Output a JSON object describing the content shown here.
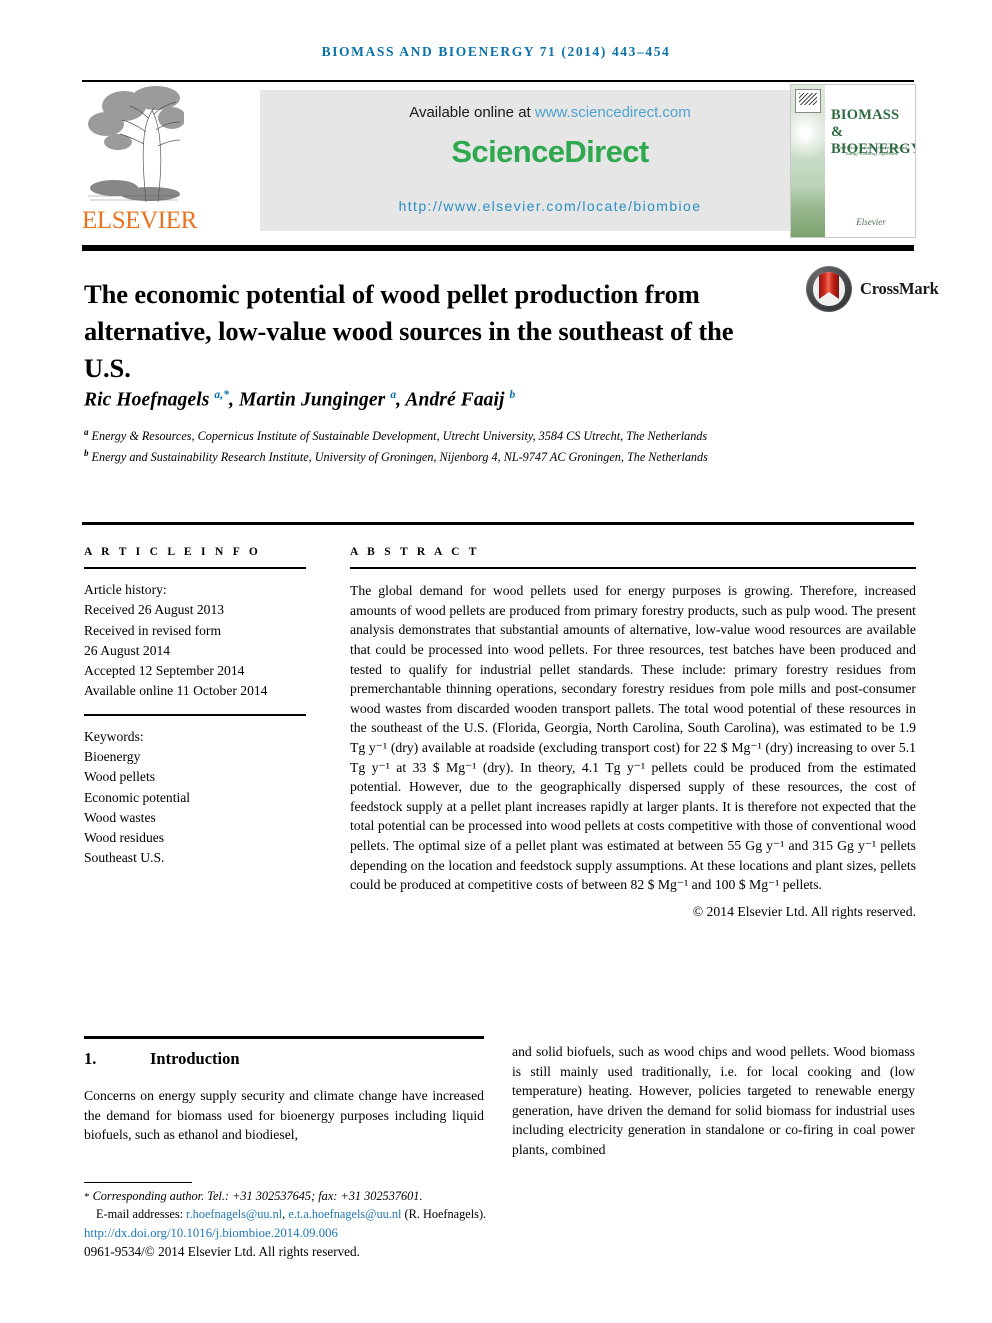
{
  "running_head": "BIOMASS AND BIOENERGY 71 (2014) 443–454",
  "banner": {
    "publisher_logo_text": "ELSEVIER",
    "available_online_prefix": "Available online at ",
    "sciencedirect_url": "www.sciencedirect.com",
    "sciencedirect_logo": "ScienceDirect",
    "journal_url": "http://www.elsevier.com/locate/biombioe",
    "cover": {
      "title_line1": "BIOMASS &",
      "title_line2": "BIOENERGY",
      "subtitle": "The Official Journal of the International Energy Bioenergy Agreement",
      "publisher": "Elsevier"
    }
  },
  "crossmark": {
    "label": "CrossMark"
  },
  "article": {
    "title": "The economic potential of wood pellet production from alternative, low-value wood sources in the southeast of the U.S.",
    "authors_html": "Ric Hoefnagels <sup>a,*</sup>, Martin Junginger <sup>a</sup>, André Faaij <sup>b</sup>",
    "affiliations": [
      {
        "marker": "a",
        "text": "Energy & Resources, Copernicus Institute of Sustainable Development, Utrecht University, 3584 CS Utrecht, The Netherlands"
      },
      {
        "marker": "b",
        "text": "Energy and Sustainability Research Institute, University of Groningen, Nijenborg 4, NL-9747 AC Groningen, The Netherlands"
      }
    ]
  },
  "article_info": {
    "heading": "A R T I C L E   I N F O",
    "history_label": "Article history:",
    "history": [
      "Received 26 August 2013",
      "Received in revised form",
      "26 August 2014",
      "Accepted 12 September 2014",
      "Available online 11 October 2014"
    ],
    "keywords_label": "Keywords:",
    "keywords": [
      "Bioenergy",
      "Wood pellets",
      "Economic potential",
      "Wood wastes",
      "Wood residues",
      "Southeast U.S."
    ]
  },
  "abstract": {
    "heading": "A B S T R A C T",
    "text": "The global demand for wood pellets used for energy purposes is growing. Therefore, increased amounts of wood pellets are produced from primary forestry products, such as pulp wood. The present analysis demonstrates that substantial amounts of alternative, low-value wood resources are available that could be processed into wood pellets. For three resources, test batches have been produced and tested to qualify for industrial pellet standards. These include: primary forestry residues from premerchantable thinning operations, secondary forestry residues from pole mills and post-consumer wood wastes from discarded wooden transport pallets. The total wood potential of these resources in the southeast of the U.S. (Florida, Georgia, North Carolina, South Carolina), was estimated to be 1.9 Tg y⁻¹ (dry) available at roadside (excluding transport cost) for 22 $ Mg⁻¹ (dry) increasing to over 5.1 Tg y⁻¹ at 33 $ Mg⁻¹ (dry). In theory, 4.1 Tg y⁻¹ pellets could be produced from the estimated potential. However, due to the geographically dispersed supply of these resources, the cost of feedstock supply at a pellet plant increases rapidly at larger plants. It is therefore not expected that the total potential can be processed into wood pellets at costs competitive with those of conventional wood pellets. The optimal size of a pellet plant was estimated at between 55 Gg y⁻¹ and 315 Gg y⁻¹ pellets depending on the location and feedstock supply assumptions. At these locations and plant sizes, pellets could be produced at competitive costs of between 82 $ Mg⁻¹ and 100 $ Mg⁻¹ pellets.",
    "copyright": "© 2014 Elsevier Ltd. All rights reserved."
  },
  "body": {
    "section_number": "1.",
    "section_title": "Introduction",
    "column_left": "Concerns on energy supply security and climate change have increased the demand for biomass used for bioenergy purposes including liquid biofuels, such as ethanol and biodiesel,",
    "column_right": "and solid biofuels, such as wood chips and wood pellets. Wood biomass is still mainly used traditionally, i.e. for local cooking and (low temperature) heating. However, policies targeted to renewable energy generation, have driven the demand for solid biomass for industrial uses including electricity generation in standalone or co-firing in coal power plants, combined"
  },
  "footer": {
    "corresponding": "Corresponding author. Tel.: +31 302537645; fax: +31 302537601.",
    "email_label": "E-mail addresses:",
    "email1": "r.hoefnagels@uu.nl",
    "email2": "e.t.a.hoefnagels@uu.nl",
    "email_suffix": "(R. Hoefnagels).",
    "doi": "http://dx.doi.org/10.1016/j.biombioe.2014.09.006",
    "issn_line": "0961-9534/© 2014 Elsevier Ltd. All rights reserved."
  },
  "colors": {
    "accent_blue": "#0a72a8",
    "link_blue": "#1f77b4",
    "sciencedirect_green": "#2fa84f",
    "elsevier_orange": "#e87422",
    "crossmark_red": "#d2281c"
  }
}
